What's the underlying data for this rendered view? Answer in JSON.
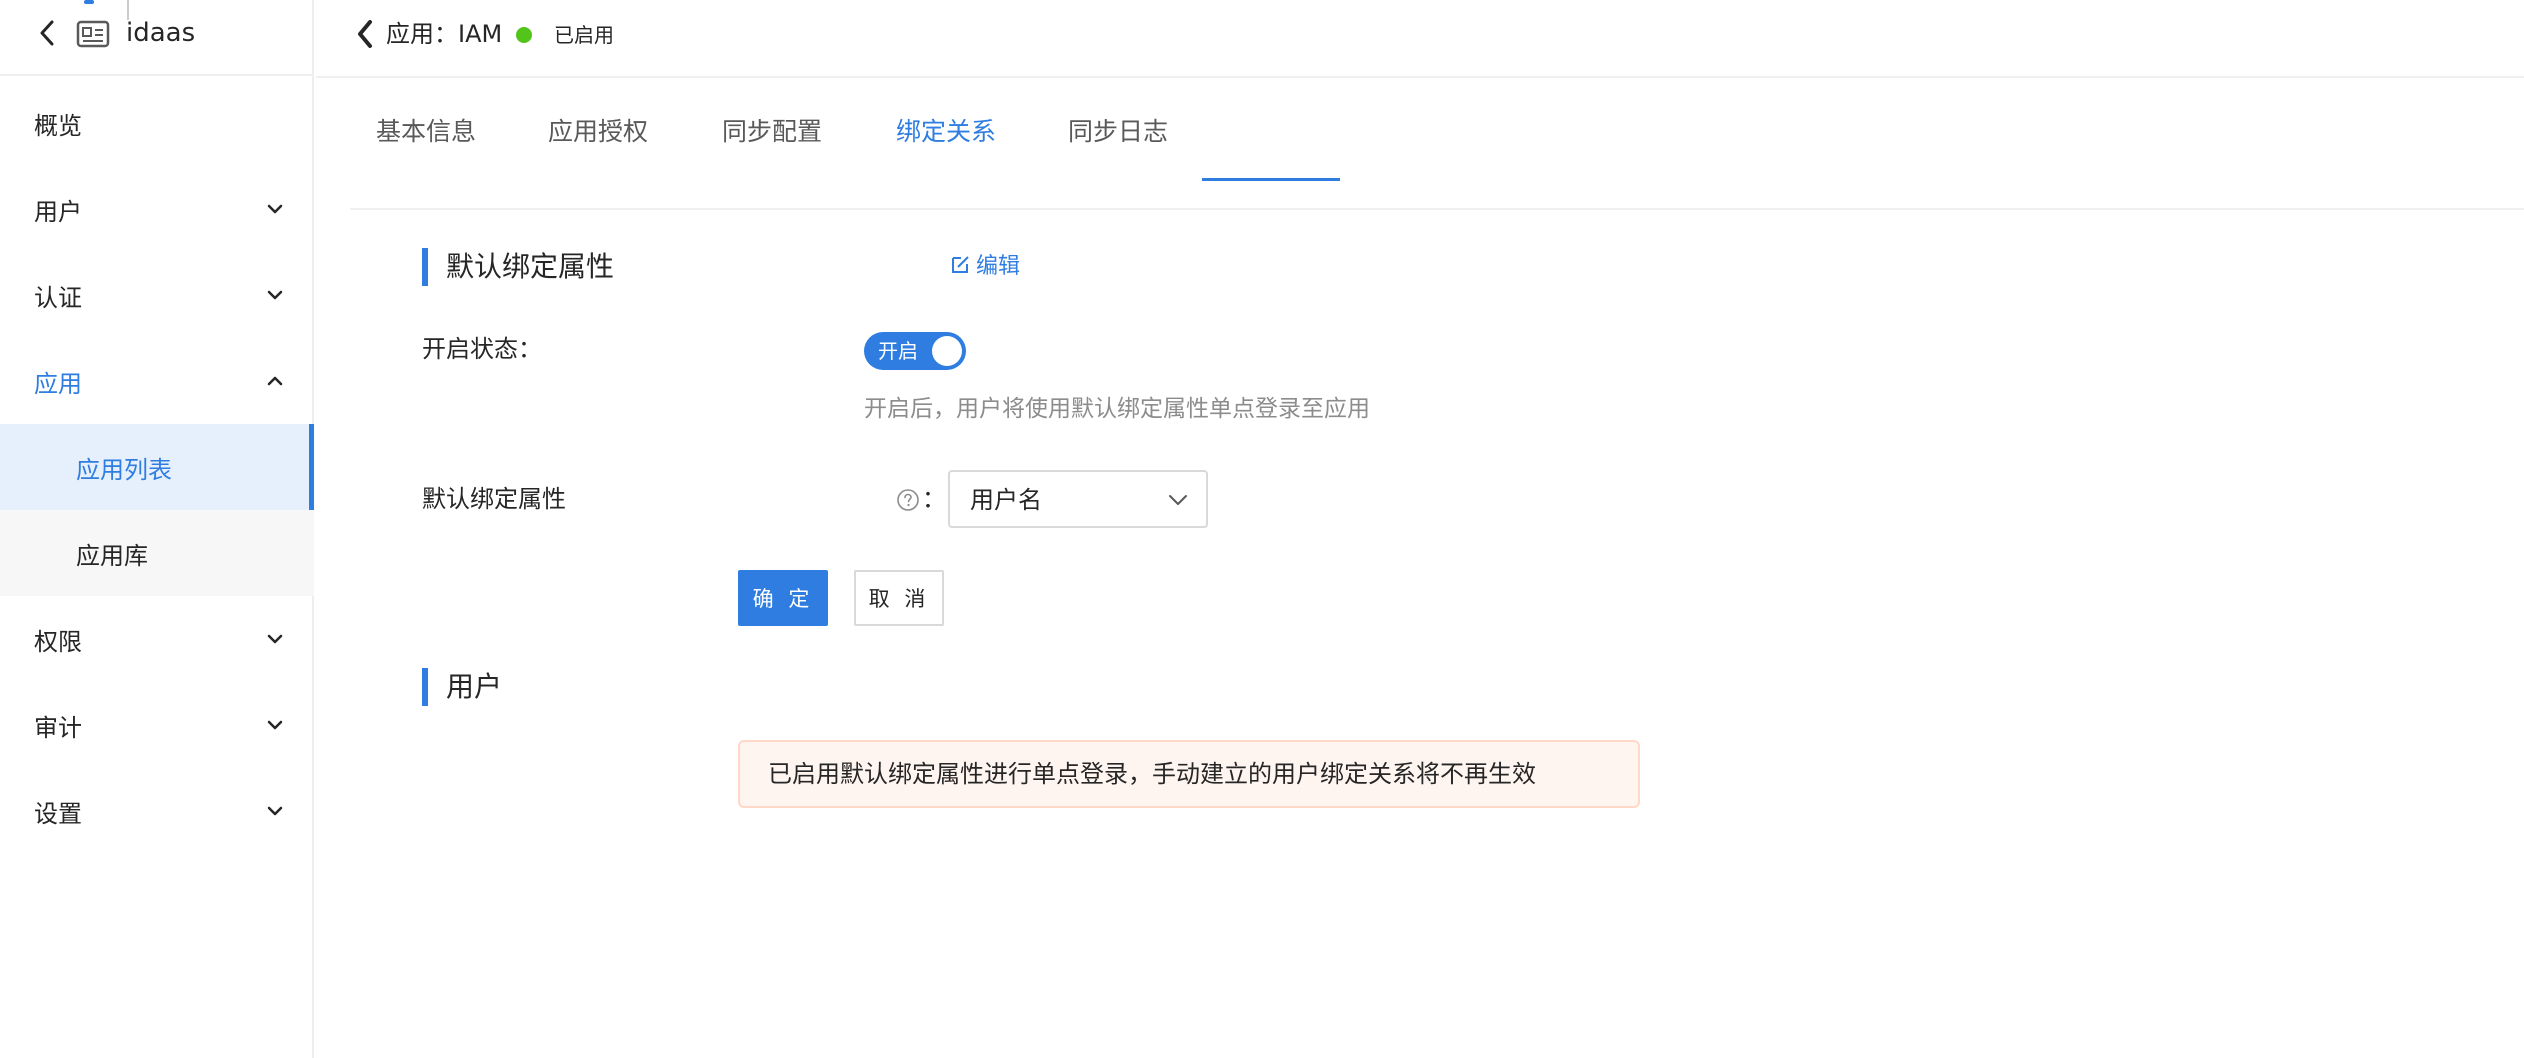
{
  "sidebar": {
    "brand": "idaas",
    "menu": [
      {
        "label": "概览"
      },
      {
        "label": "用户"
      },
      {
        "label": "认证"
      },
      {
        "label": "应用"
      },
      {
        "label": "权限"
      },
      {
        "label": "审计"
      },
      {
        "label": "设置"
      }
    ],
    "app_submenu": [
      {
        "label": "应用列表"
      },
      {
        "label": "应用库"
      }
    ]
  },
  "header": {
    "title": "应用：IAM",
    "status": "已启用",
    "status_color": "#52c41a"
  },
  "tabs": [
    {
      "label": "基本信息"
    },
    {
      "label": "应用授权"
    },
    {
      "label": "同步配置"
    },
    {
      "label": "绑定关系"
    },
    {
      "label": "同步日志"
    }
  ],
  "binding_section": {
    "title": "默认绑定属性",
    "edit_label": "编辑",
    "enable_label": "开启状态：",
    "toggle_label": "开启",
    "toggle_on": true,
    "hint": "开启后，用户将使用默认绑定属性单点登录至应用",
    "attribute_label": "默认绑定属性",
    "attribute_colon": "：",
    "attribute_value": "用户名",
    "confirm_label": "确 定",
    "cancel_label": "取 消"
  },
  "user_section": {
    "title": "用户",
    "alert": "已启用默认绑定属性进行单点登录，手动建立的用户绑定关系将不再生效"
  },
  "colors": {
    "accent": "#2f7de1",
    "alert_bg": "#fff5f0",
    "alert_border": "#ffd8c7"
  }
}
